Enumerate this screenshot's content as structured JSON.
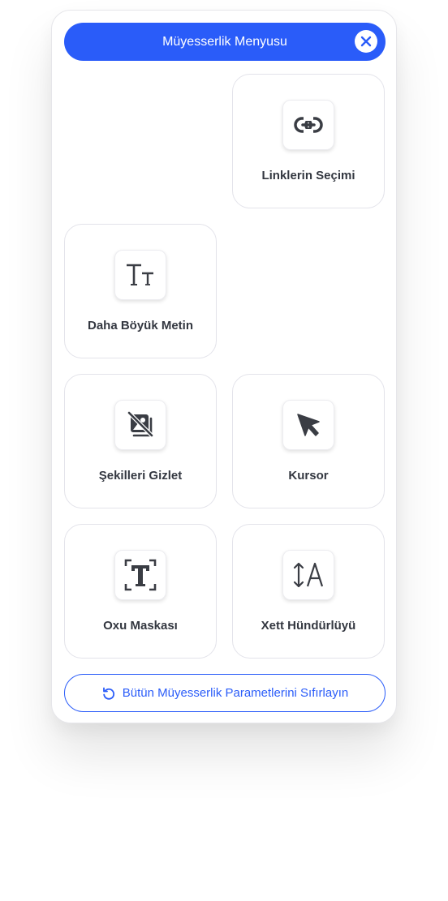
{
  "header": {
    "title": "Müyesserlik Menyusu"
  },
  "cards": [
    {
      "label": "Linklerin Seçimi",
      "icon": "link-icon"
    },
    {
      "label": "Daha Böyük Metin",
      "icon": "text-size-icon"
    },
    {
      "label": "Şekilleri Gizlet",
      "icon": "hide-images-icon"
    },
    {
      "label": "Kursor",
      "icon": "cursor-icon"
    },
    {
      "label": "Oxu Maskası",
      "icon": "reading-mask-icon"
    },
    {
      "label": "Xett Hündürlüyü",
      "icon": "line-height-icon"
    }
  ],
  "reset": {
    "label": "Bütün Müyesserlik Parametlerini Sıfırlayın"
  },
  "colors": {
    "accent": "#2a5cf9",
    "icon": "#3a3d44",
    "text": "#333740"
  }
}
